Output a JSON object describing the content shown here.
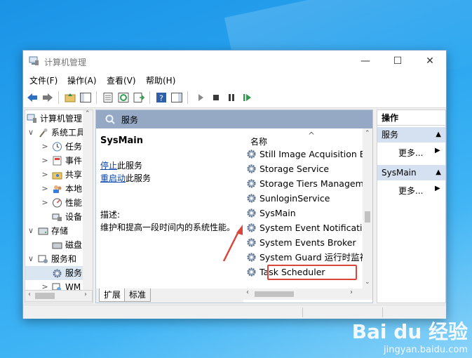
{
  "window": {
    "title": "计算机管理"
  },
  "menubar": [
    "文件(F)",
    "操作(A)",
    "查看(V)",
    "帮助(H)"
  ],
  "tree": {
    "items": [
      {
        "label": "计算机管理",
        "indent": 0,
        "expander": "",
        "icon": "computer-management-icon"
      },
      {
        "label": "系统工具",
        "indent": 1,
        "expander": "∨",
        "icon": "tools-icon"
      },
      {
        "label": "任务",
        "indent": 2,
        "expander": ">",
        "icon": "task-scheduler-icon"
      },
      {
        "label": "事件",
        "indent": 2,
        "expander": ">",
        "icon": "event-viewer-icon"
      },
      {
        "label": "共享",
        "indent": 2,
        "expander": ">",
        "icon": "shared-folder-icon"
      },
      {
        "label": "本地",
        "indent": 2,
        "expander": ">",
        "icon": "local-users-icon"
      },
      {
        "label": "性能",
        "indent": 2,
        "expander": ">",
        "icon": "performance-icon"
      },
      {
        "label": "设备",
        "indent": 2,
        "expander": "",
        "icon": "device-manager-icon"
      },
      {
        "label": "存储",
        "indent": 1,
        "expander": "∨",
        "icon": "storage-icon"
      },
      {
        "label": "磁盘",
        "indent": 2,
        "expander": "",
        "icon": "disk-management-icon"
      },
      {
        "label": "服务和",
        "indent": 1,
        "expander": "∨",
        "icon": "services-apps-icon"
      },
      {
        "label": "服务",
        "indent": 2,
        "expander": "",
        "icon": "services-gear-icon"
      },
      {
        "label": "WM",
        "indent": 2,
        "expander": ">",
        "icon": "wmi-icon"
      }
    ]
  },
  "center": {
    "header": "服务",
    "service_name": "SysMain",
    "stop_link": "停止",
    "stop_rest": "此服务",
    "restart_link": "重启动",
    "restart_rest": "此服务",
    "description_label": "描述:",
    "description": "维护和提高一段时间内的系统性能。",
    "column_name": "名称",
    "services": [
      "Still Image Acquisition Ev",
      "Storage Service",
      "Storage Tiers Managem...",
      "SunloginService",
      "SysMain",
      "System Event Notificatio",
      "System Events Broker",
      "System Guard 运行时监视",
      "Task Scheduler"
    ],
    "tabs": [
      "扩展",
      "标准"
    ]
  },
  "actions": {
    "title": "操作",
    "groups": [
      {
        "label": "服务",
        "item": "更多..."
      },
      {
        "label": "SysMain",
        "item": "更多..."
      }
    ]
  },
  "watermark": {
    "logo": "Bai du 经验",
    "url": "jingyan.baidu.com"
  }
}
